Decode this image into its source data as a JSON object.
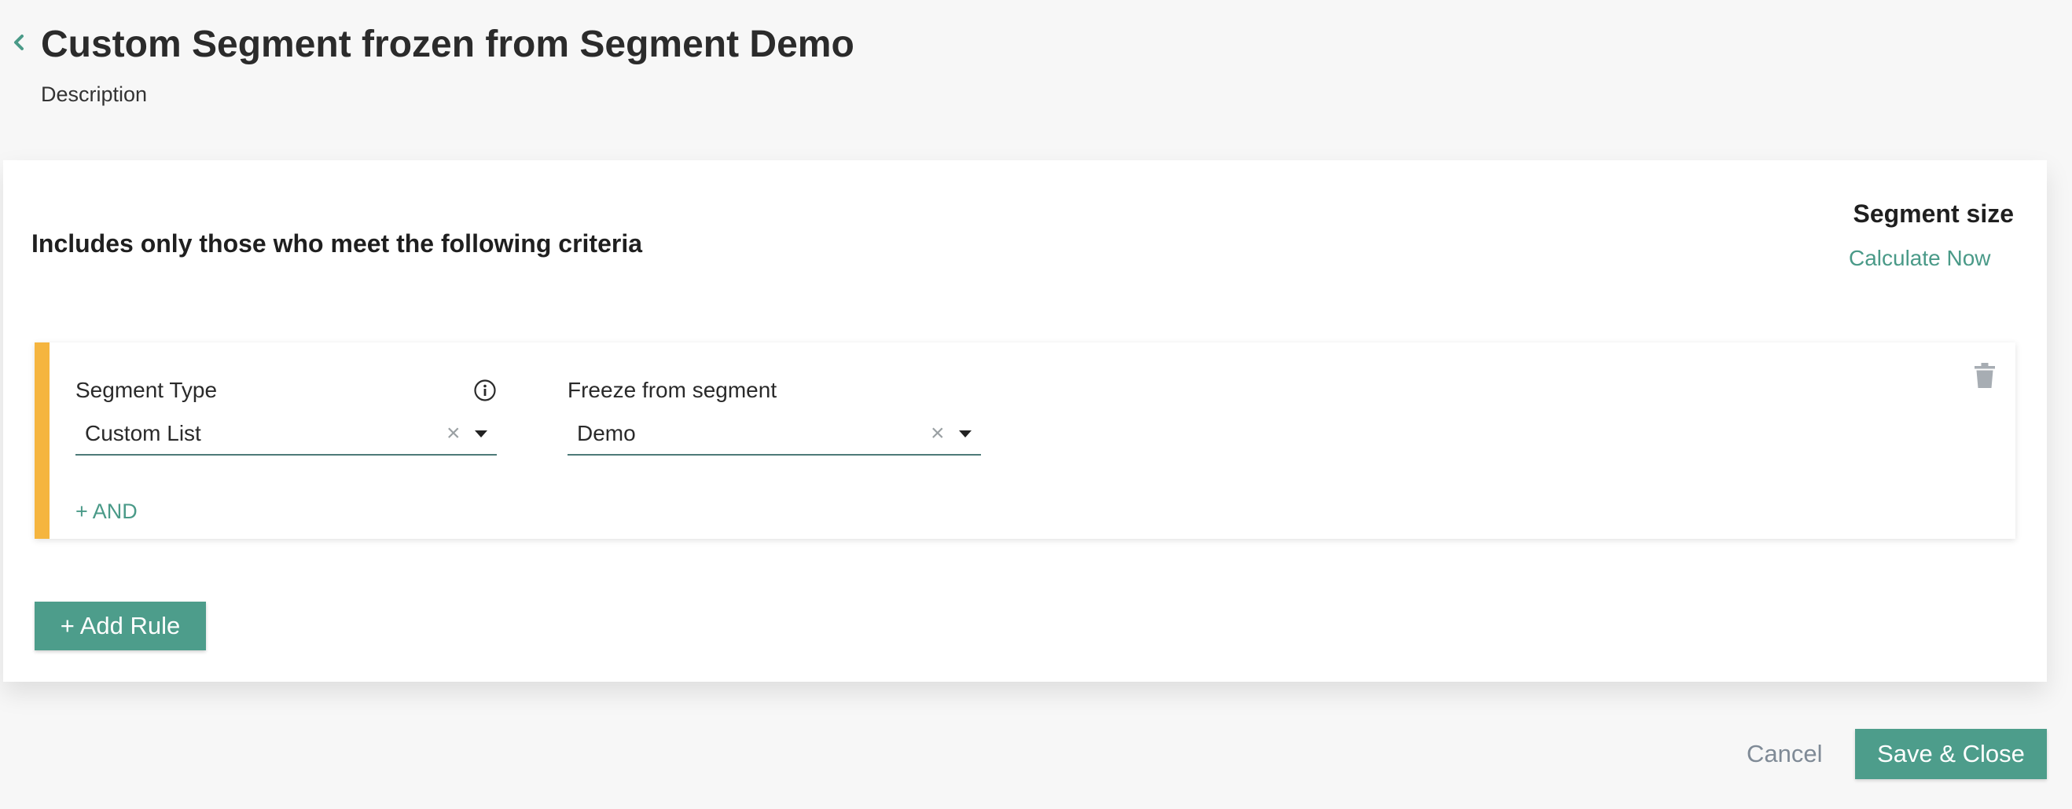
{
  "header": {
    "title": "Custom Segment frozen from Segment Demo",
    "description": "Description",
    "back_icon": "chevron-left-icon"
  },
  "card": {
    "criteria_heading": "Includes only those who meet the following criteria",
    "segment_size": {
      "label": "Segment size",
      "action": "Calculate Now"
    },
    "rules": [
      {
        "segment_type": {
          "label": "Segment Type",
          "value": "Custom List",
          "info_icon": "info-icon"
        },
        "freeze_from_segment": {
          "label": "Freeze from segment",
          "value": "Demo"
        },
        "and_label": "+ AND",
        "delete_icon": "trash-icon"
      }
    ],
    "add_rule_label": "+ Add Rule"
  },
  "footer": {
    "cancel_label": "Cancel",
    "save_label": "Save & Close"
  },
  "colors": {
    "accent": "#4d9d8b",
    "link": "#4a9a88",
    "rule_bar": "#f5b53f",
    "background": "#f7f7f7"
  }
}
